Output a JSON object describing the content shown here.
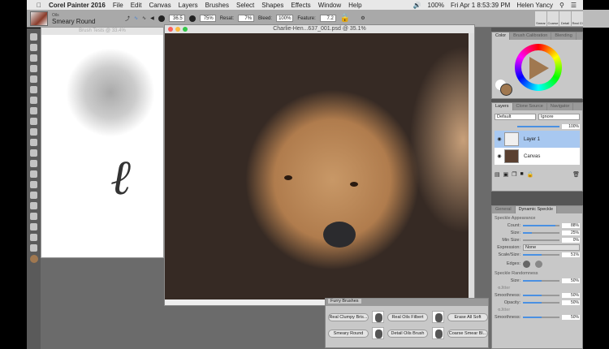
{
  "menubar": {
    "app": "Corel Painter 2016",
    "items": [
      "File",
      "Edit",
      "Canvas",
      "Layers",
      "Brushes",
      "Select",
      "Shapes",
      "Effects",
      "Window",
      "Help"
    ],
    "battery": "100%",
    "datetime": "Fri Apr 1  8:53:39 PM",
    "user": "Helen Yancy"
  },
  "toolbar": {
    "brush_category": "Oils",
    "brush_variant": "Smeary Round",
    "size": "36.5",
    "opacity": "75%",
    "resat_label": "Resat:",
    "resat": "7%",
    "bleed_label": "Bleed:",
    "bleed": "100%",
    "feature_label": "Feature:",
    "feature": "7.2",
    "recent_brushes": [
      "Smear",
      "Coarse",
      "Detail",
      "Real Cl"
    ]
  },
  "brush_window": {
    "title": "Brush Tests @ 33.4%"
  },
  "doc_window": {
    "title": "Charlie-Hen...637_001.psd @ 35.1%"
  },
  "color_panel": {
    "tabs": [
      "Color",
      "Brush Calibration",
      "Blending"
    ],
    "main_color": "#a07850",
    "secondary_color": "#ffffff"
  },
  "layers_panel": {
    "tabs": [
      "Layers",
      "Clone Source",
      "Navigator"
    ],
    "blend_mode": "Default",
    "composite": "Ignore",
    "opacity": "100%",
    "layers": [
      {
        "name": "Layer 1",
        "selected": true
      },
      {
        "name": "Canvas",
        "selected": false
      }
    ]
  },
  "speckle_panel": {
    "tabs": [
      "General",
      "Dynamic Speckle"
    ],
    "appearance_title": "Speckle Appearance",
    "appearance": [
      {
        "label": "Count:",
        "value": "88%",
        "fill": 88
      },
      {
        "label": "Size:",
        "value": "25%",
        "fill": 25
      },
      {
        "label": "Min Size:",
        "value": "0%",
        "fill": 0
      }
    ],
    "expression_label": "Expression:",
    "expression": "None",
    "scale_label": "Scale/Size:",
    "scale": "51%",
    "edges_label": "Edges:",
    "randomness_title": "Speckle Randomness",
    "size_label": "Size:",
    "size": "50%",
    "jitter": "Jitter",
    "smoothness_label": "Smoothness:",
    "smoothness": "50%",
    "opacity_label": "Opacity:",
    "opacity": "50%",
    "jitter2": "Jitter",
    "smoothness2": "50%"
  },
  "furry_panel": {
    "title": "Furry Brushes",
    "brushes": [
      "Real Clumpy Bris...",
      "Real Oils Filbert",
      "Erase All Soft",
      "Smeary Round",
      "Detail Oils Brush",
      "Coarse Smear Bl..."
    ]
  }
}
